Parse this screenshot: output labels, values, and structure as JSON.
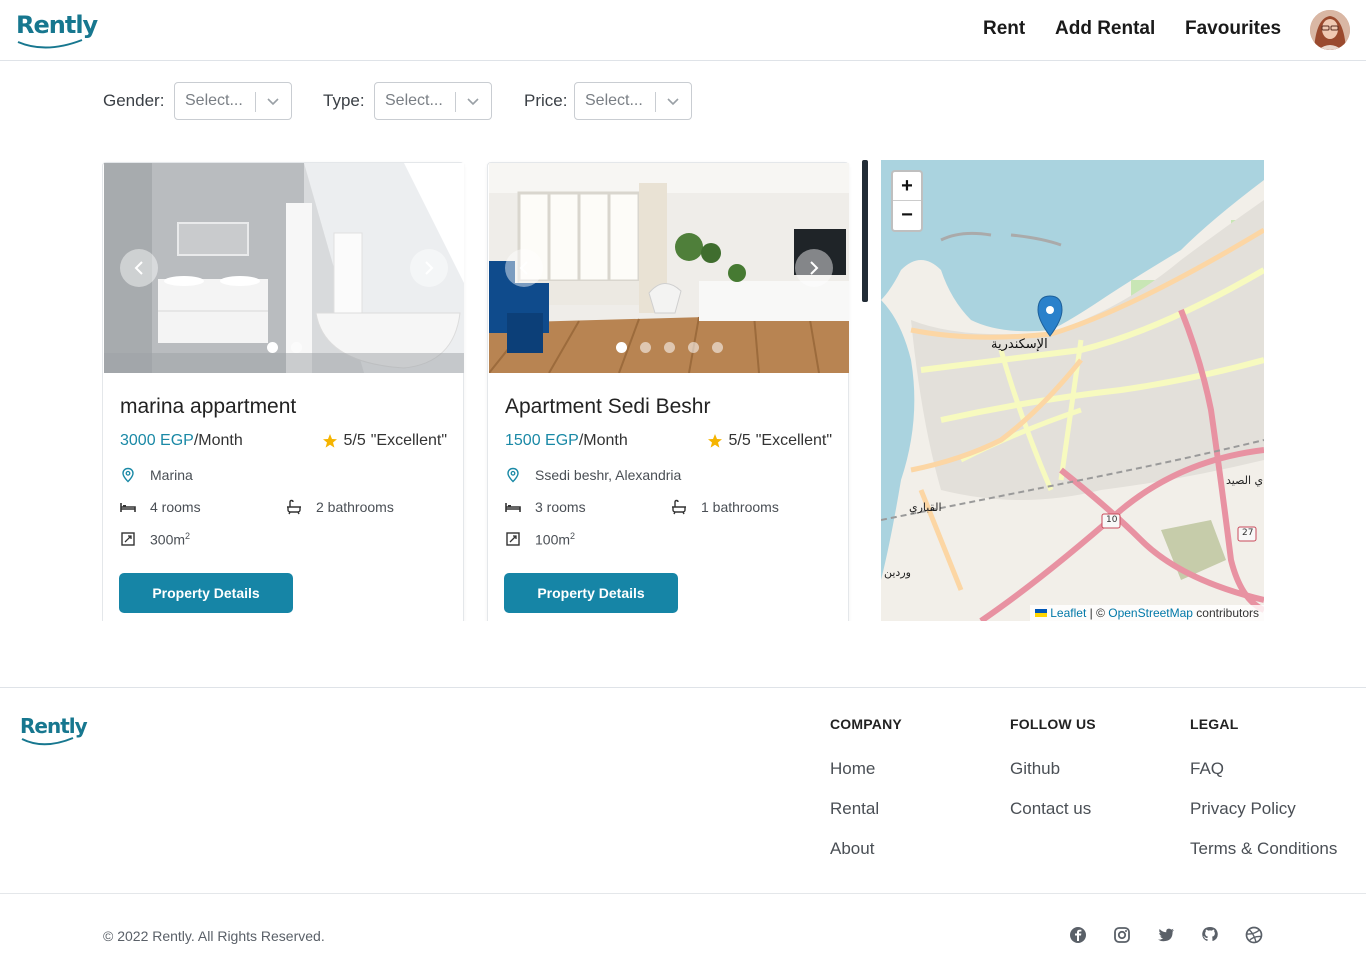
{
  "header": {
    "logo": "Rently",
    "nav": {
      "rent": "Rent",
      "add_rental": "Add Rental",
      "favourites": "Favourites"
    }
  },
  "filters": {
    "gender": {
      "label": "Gender:",
      "placeholder": "Select..."
    },
    "type": {
      "label": "Type:",
      "placeholder": "Select..."
    },
    "price": {
      "label": "Price:",
      "placeholder": "Select..."
    }
  },
  "listings": [
    {
      "title": "marina appartment",
      "price_amount": "3000 EGP",
      "price_period": "/Month",
      "rating": "5/5",
      "rating_text": "\"Excellent\"",
      "location": "Marina",
      "rooms": "4 rooms",
      "bathrooms": "2 bathrooms",
      "area": "300m",
      "area_unit_sup": "2",
      "button": "Property Details",
      "image_count": 2,
      "active_image": 1
    },
    {
      "title": "Apartment Sedi Beshr",
      "price_amount": "1500 EGP",
      "price_period": "/Month",
      "rating": "5/5",
      "rating_text": "\"Excellent\"",
      "location": "Ssedi beshr, Alexandria",
      "rooms": "3 rooms",
      "bathrooms": "1 bathrooms",
      "area": "100m",
      "area_unit_sup": "2",
      "button": "Property Details",
      "image_count": 5,
      "active_image": 1
    }
  ],
  "map": {
    "zoom_in": "+",
    "zoom_out": "−",
    "city_label": "الإسكندرية",
    "label_qabbari": "القباري",
    "label_wardian": "وردين",
    "label_sayed": "ي الصيد",
    "road_10": "10",
    "road_27": "27",
    "attribution_leaflet": "Leaflet",
    "attribution_sep": " | © ",
    "attribution_osm": "OpenStreetMap",
    "attribution_tail": " contributors"
  },
  "footer": {
    "logo": "Rently",
    "company": {
      "heading": "COMPANY",
      "links": [
        "Home",
        "Rental",
        "About"
      ]
    },
    "follow": {
      "heading": "FOLLOW US",
      "links": [
        "Github",
        "Contact us"
      ]
    },
    "legal": {
      "heading": "LEGAL",
      "links": [
        "FAQ",
        "Privacy Policy",
        "Terms & Conditions"
      ]
    },
    "copyright": "© 2022 Rently. All Rights Reserved.",
    "social_icons": [
      "facebook-icon",
      "instagram-icon",
      "twitter-icon",
      "github-icon",
      "dribbble-icon"
    ]
  },
  "colors": {
    "brand": "#1685a6",
    "price": "#1a89a6",
    "star": "#f5b400",
    "map_water": "#aad3df"
  }
}
